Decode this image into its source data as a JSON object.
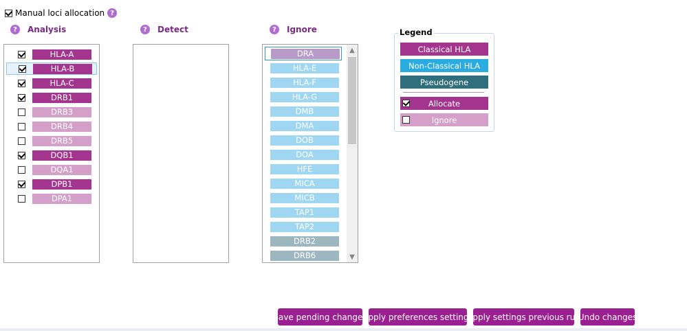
{
  "manual": {
    "label": "Manual loci allocation",
    "checked": true
  },
  "columns": {
    "analysis": "Analysis",
    "detect": "Detect",
    "ignore": "Ignore"
  },
  "colors": {
    "classical": "#a3358f",
    "classical_light": "#d49fc8",
    "nonclassical": "#9fd6f1",
    "nonclassical_selected": "#b89ac9",
    "pseudogene": "#9db7c1",
    "legend_nonclassical": "#2bace1",
    "legend_pseudogene": "#2f6e7c",
    "button": "#9a1f91"
  },
  "analysis_items": [
    {
      "label": "HLA-A",
      "checked": true
    },
    {
      "label": "HLA-B",
      "checked": true,
      "selected": true
    },
    {
      "label": "HLA-C",
      "checked": true
    },
    {
      "label": "DRB1",
      "checked": true
    },
    {
      "label": "DRB3",
      "checked": false
    },
    {
      "label": "DRB4",
      "checked": false
    },
    {
      "label": "DRB5",
      "checked": false
    },
    {
      "label": "DQB1",
      "checked": true
    },
    {
      "label": "DQA1",
      "checked": false
    },
    {
      "label": "DPB1",
      "checked": true
    },
    {
      "label": "DPA1",
      "checked": false
    }
  ],
  "detect_items": [],
  "ignore_items": [
    {
      "label": "DRA",
      "kind": "selected"
    },
    {
      "label": "HLA-E",
      "kind": "nonclassical"
    },
    {
      "label": "HLA-F",
      "kind": "nonclassical"
    },
    {
      "label": "HLA-G",
      "kind": "nonclassical"
    },
    {
      "label": "DMB",
      "kind": "nonclassical"
    },
    {
      "label": "DMA",
      "kind": "nonclassical"
    },
    {
      "label": "DOB",
      "kind": "nonclassical"
    },
    {
      "label": "DOA",
      "kind": "nonclassical"
    },
    {
      "label": "HFE",
      "kind": "nonclassical"
    },
    {
      "label": "MICA",
      "kind": "nonclassical"
    },
    {
      "label": "MICB",
      "kind": "nonclassical"
    },
    {
      "label": "TAP1",
      "kind": "nonclassical"
    },
    {
      "label": "TAP2",
      "kind": "nonclassical"
    },
    {
      "label": "DRB2",
      "kind": "pseudogene"
    },
    {
      "label": "DRB6",
      "kind": "pseudogene"
    }
  ],
  "legend": {
    "title": "Legend",
    "classical": "Classical HLA",
    "nonclassical": "Non-Classical HLA",
    "pseudogene": "Pseudogene",
    "allocate": "Allocate",
    "ignore": "Ignore"
  },
  "buttons": {
    "save": "Save pending changes",
    "apply_prefs": "Apply preferences settings",
    "apply_prev": "Apply settings previous run",
    "undo": "Undo changes"
  }
}
